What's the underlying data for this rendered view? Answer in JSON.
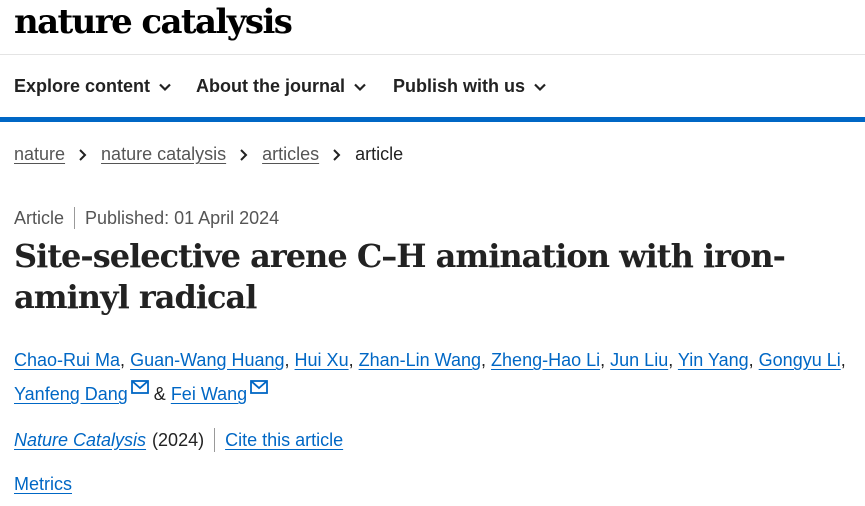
{
  "header": {
    "logo_text": "nature catalysis"
  },
  "nav": {
    "items": [
      {
        "label": "Explore content"
      },
      {
        "label": "About the journal"
      },
      {
        "label": "Publish with us"
      }
    ]
  },
  "breadcrumb": {
    "items": [
      "nature",
      "nature catalysis",
      "articles"
    ],
    "current": "article"
  },
  "article": {
    "type": "Article",
    "published": "Published: 01 April 2024",
    "title": "Site-selective arene C–H amination with iron-aminyl radical",
    "authors": [
      {
        "name": "Chao-Rui Ma"
      },
      {
        "name": "Guan-Wang Huang"
      },
      {
        "name": "Hui Xu"
      },
      {
        "name": "Zhan-Lin Wang"
      },
      {
        "name": "Zheng-Hao Li"
      },
      {
        "name": "Jun Liu"
      },
      {
        "name": "Yin Yang"
      },
      {
        "name": "Gongyu Li"
      },
      {
        "name": "Yanfeng Dang"
      },
      {
        "name": "Fei Wang"
      }
    ],
    "author_separator": ",",
    "author_conjunction": "&",
    "journal": "Nature Catalysis",
    "year": "(2024)",
    "cite_label": "Cite this article",
    "metrics_label": "Metrics"
  },
  "colors": {
    "link": "#0067c5",
    "nav_border": "#0067c5",
    "text": "#222222",
    "muted": "#555555"
  },
  "icons": {
    "nav_dropdown": "chevron-down-icon",
    "breadcrumb_sep": "chevron-right-icon",
    "author_contact": "mail-icon"
  }
}
